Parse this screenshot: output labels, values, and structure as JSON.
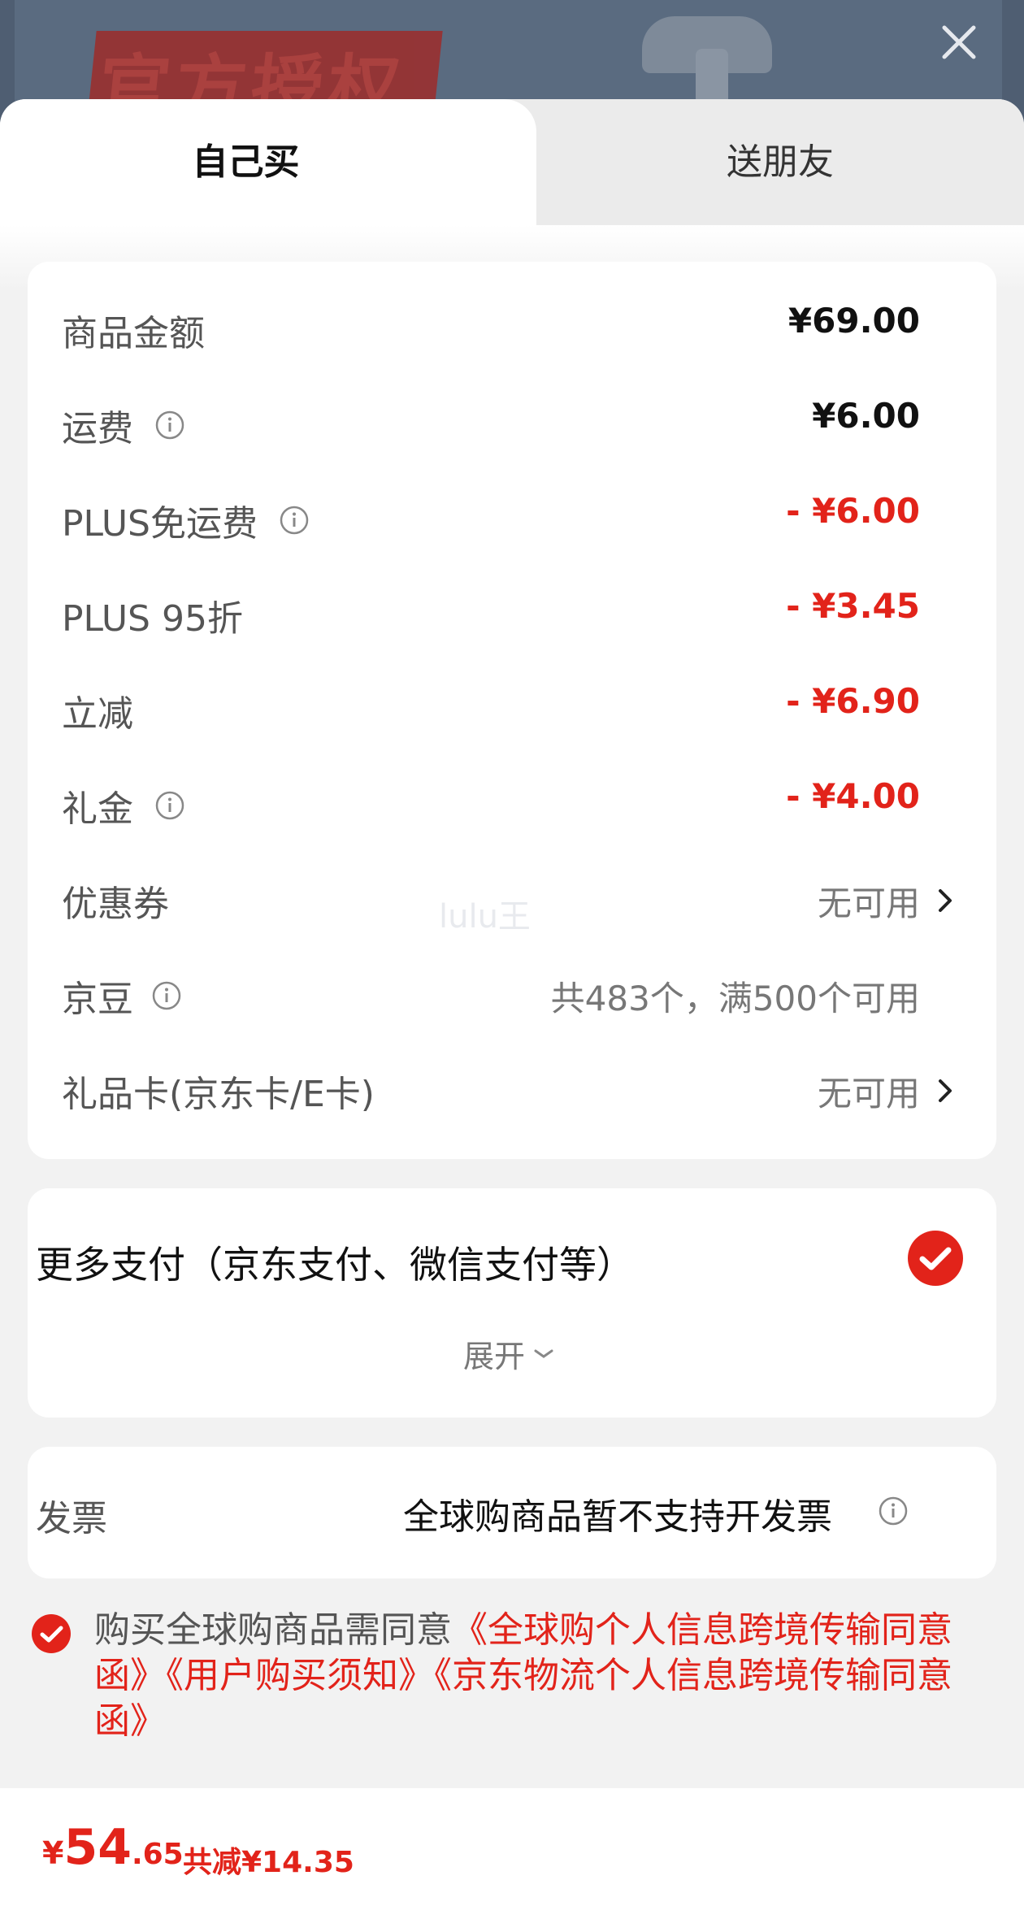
{
  "banner": {
    "text": "官方授权"
  },
  "tabs": [
    {
      "label": "自己买",
      "active": true
    },
    {
      "label": "送朋友",
      "active": false
    }
  ],
  "summary": {
    "rows": [
      {
        "label": "商品金额",
        "value": "¥69.00"
      },
      {
        "label": "运费",
        "value": "¥6.00"
      },
      {
        "label": "PLUS免运费",
        "value": "- ¥6.00"
      },
      {
        "label": "PLUS 95折",
        "value": "- ¥3.45"
      },
      {
        "label": "立减",
        "value": "- ¥6.90"
      },
      {
        "label": "礼金",
        "value": "- ¥4.00"
      },
      {
        "label": "优惠券",
        "value": "无可用"
      },
      {
        "label": "京豆",
        "value": "共483个，满500个可用"
      },
      {
        "label": "礼品卡(京东卡/E卡)",
        "value": "无可用"
      }
    ]
  },
  "watermark": "lulu王",
  "payment": {
    "label": "更多支付（京东支付、微信支付等）",
    "expand_label": "展开"
  },
  "invoice": {
    "label": "发票",
    "value": "全球购商品暂不支持开发票"
  },
  "agreement": {
    "prefix": "购买全球购商品需同意",
    "link1": "《全球购个人信息跨境传输同意函》",
    "link2": "《用户购买须知》",
    "link3": "《京东物流个人信息跨境传输同意函》"
  },
  "footer": {
    "currency": "¥",
    "price_int": "54",
    "price_dec": ".65",
    "saved": "共减¥14.35"
  },
  "colors": {
    "accent": "#e2231a",
    "background": "#f2f2f2",
    "card": "#ffffff"
  }
}
